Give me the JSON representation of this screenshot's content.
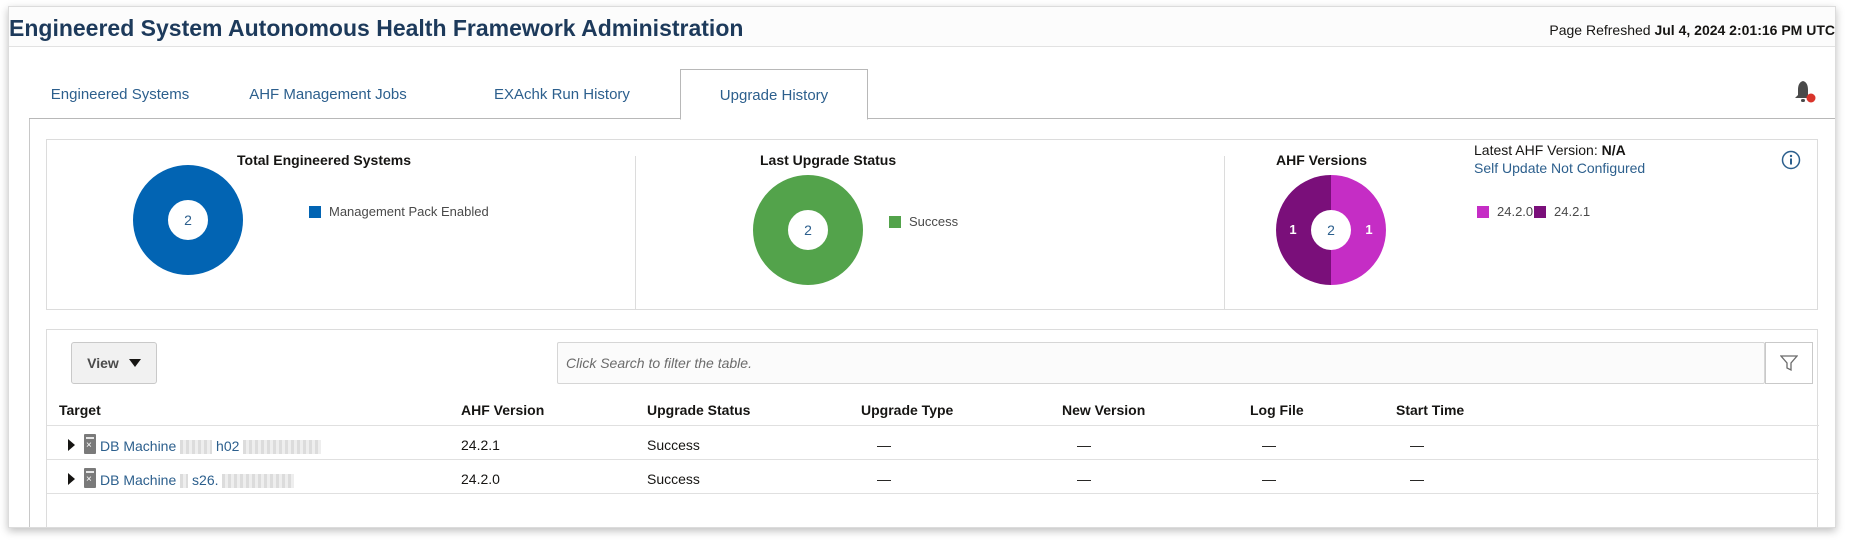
{
  "header": {
    "title": "Engineered System Autonomous Health Framework Administration",
    "refreshed_label": "Page Refreshed",
    "refreshed_value": "Jul 4, 2024 2:01:16 PM UTC"
  },
  "tabs": [
    {
      "label": "Engineered Systems",
      "active": false
    },
    {
      "label": "AHF Management Jobs",
      "active": false
    },
    {
      "label": "EXAchk Run History",
      "active": false
    },
    {
      "label": "Upgrade History",
      "active": true
    }
  ],
  "icons": {
    "notification": "bell-icon",
    "info": "info-icon",
    "filter": "filter-icon",
    "view_caret": "caret-down-icon",
    "server": "server-icon",
    "expand": "expand-arrow-icon"
  },
  "summary": {
    "total_systems": {
      "title": "Total Engineered Systems",
      "center_value": "2",
      "segments": [
        {
          "label": "Management Pack Enabled",
          "value": 2,
          "color": "#0264b3"
        }
      ]
    },
    "last_upgrade": {
      "title": "Last Upgrade Status",
      "center_value": "2",
      "segments": [
        {
          "label": "Success",
          "value": 2,
          "color": "#53a34b"
        }
      ]
    },
    "ahf_versions": {
      "title": "AHF Versions",
      "center_value": "2",
      "segments": [
        {
          "label": "24.2.0",
          "value": 1,
          "color": "#c52dc5"
        },
        {
          "label": "24.2.1",
          "value": 1,
          "color": "#7a0f7a"
        }
      ],
      "latest_label": "Latest AHF Version:",
      "latest_value": "N/A",
      "self_update": "Self Update Not Configured"
    }
  },
  "toolbar": {
    "view_label": "View",
    "search_placeholder": "Click Search to filter the table."
  },
  "table": {
    "columns": [
      "Target",
      "AHF Version",
      "Upgrade Status",
      "Upgrade Type",
      "New Version",
      "Log File",
      "Start Time"
    ],
    "rows": [
      {
        "target_prefix": "DB Machine",
        "target_visible": "h02",
        "ahf_version": "24.2.1",
        "status": "Success",
        "upgrade_type": "—",
        "new_version": "—",
        "log_file": "—",
        "start_time": "—"
      },
      {
        "target_prefix": "DB Machine",
        "target_visible": "s26.",
        "ahf_version": "24.2.0",
        "status": "Success",
        "upgrade_type": "—",
        "new_version": "—",
        "log_file": "—",
        "start_time": "—"
      }
    ]
  }
}
